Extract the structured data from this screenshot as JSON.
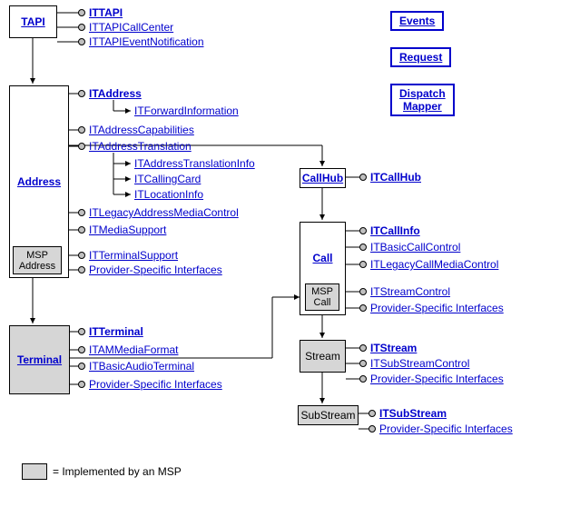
{
  "boxes": {
    "tapi": "TAPI",
    "address": "Address",
    "msp_address": "MSP\nAddress",
    "terminal": "Terminal",
    "callhub": "CallHub",
    "call": "Call",
    "msp_call": "MSP\nCall",
    "stream": "Stream",
    "substream": "SubStream"
  },
  "sideboxes": {
    "events": "Events",
    "request": "Request",
    "dispatch": "Dispatch\nMapper"
  },
  "tapi_ifaces": {
    "ittapi": "ITTAPI",
    "callcenter": "ITTAPICallCenter",
    "eventnotif": "ITTAPIEventNotification"
  },
  "address_ifaces": {
    "itaddress": "ITAddress",
    "forwardinfo": "ITForwardInformation",
    "addrcaps": "ITAddressCapabilities",
    "addrtrans": "ITAddressTranslation",
    "addrtransinfo": "ITAddressTranslationInfo",
    "callingcard": "ITCallingCard",
    "locationinfo": "ITLocationInfo",
    "legacymedia": "ITLegacyAddressMediaControl",
    "mediasupport": "ITMediaSupport",
    "termsupport": "ITTerminalSupport",
    "provider": "Provider-Specific Interfaces"
  },
  "terminal_ifaces": {
    "itterminal": "ITTerminal",
    "ammedia": "ITAMMediaFormat",
    "basicaudio": "ITBasicAudioTerminal",
    "provider": "Provider-Specific Interfaces"
  },
  "callhub_ifaces": {
    "itcallhub": "ITCallHub"
  },
  "call_ifaces": {
    "callinfo": "ITCallInfo",
    "basiccallctrl": "ITBasicCallControl",
    "legacycallmedia": "ITLegacyCallMediaControl",
    "streamctrl": "ITStreamControl",
    "provider": "Provider-Specific Interfaces"
  },
  "stream_ifaces": {
    "itstream": "ITStream",
    "substreamctrl": "ITSubStreamControl",
    "provider": "Provider-Specific Interfaces"
  },
  "substream_ifaces": {
    "itsubstream": "ITSubStream",
    "provider": "Provider-Specific Interfaces"
  },
  "legend": "= Implemented by an MSP"
}
